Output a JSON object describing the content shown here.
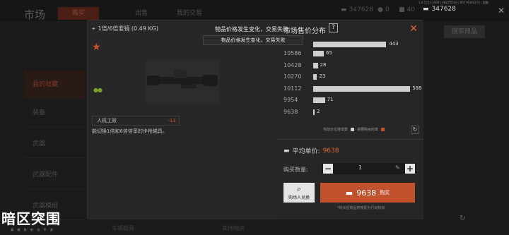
{
  "background": {
    "title": "市场",
    "tabs": [
      "出售",
      "我的交易"
    ],
    "active_tab": "购买",
    "resources": [
      "347628",
      "0",
      "40"
    ],
    "version": "1.0.155.11930 | 0822f5530 | 85776305273 | 国服",
    "money": "347628",
    "search_button": "搜索商品",
    "side_items": [
      "我的收藏",
      "装备",
      "武器",
      "武器配件",
      "武器模组"
    ],
    "bottom_tabs": [
      "车辆载具",
      "其他物资"
    ]
  },
  "item": {
    "name": "1倍/6倍准镜 (0.49 KG)",
    "stat_label": "人机工效",
    "stat_value": "-11",
    "description": "能切换1倍和6倍倍率的步枪瞄具。"
  },
  "chart_panel": {
    "title": "市场售价分布",
    "legend_current": "当前价位挂单数",
    "legend_buy": "将要购买的单"
  },
  "chart_data": {
    "type": "bar",
    "title": "市场售价分布",
    "categories": [
      "10586",
      "10428",
      "10270",
      "10112",
      "9954",
      "9638"
    ],
    "values": [
      65,
      28,
      23,
      588,
      71,
      2
    ],
    "extra_top_bar_value": 443
  },
  "purchase": {
    "avg_label": "平均单价:",
    "avg_value": "9638",
    "qty_label": "购买数量:",
    "qty_value": "1",
    "trade_label": "购场人兑换",
    "buy_amount": "9638",
    "buy_label": "购买",
    "note": "*购买后物品将被视为行动物资"
  },
  "toast": {
    "line1": "物品价格发生变化，交易失败",
    "line2": "物品价格发生变化，交易失败"
  },
  "logo": {
    "main": "暗区突围",
    "sub": "真 硬 核 射 击 手 游"
  }
}
